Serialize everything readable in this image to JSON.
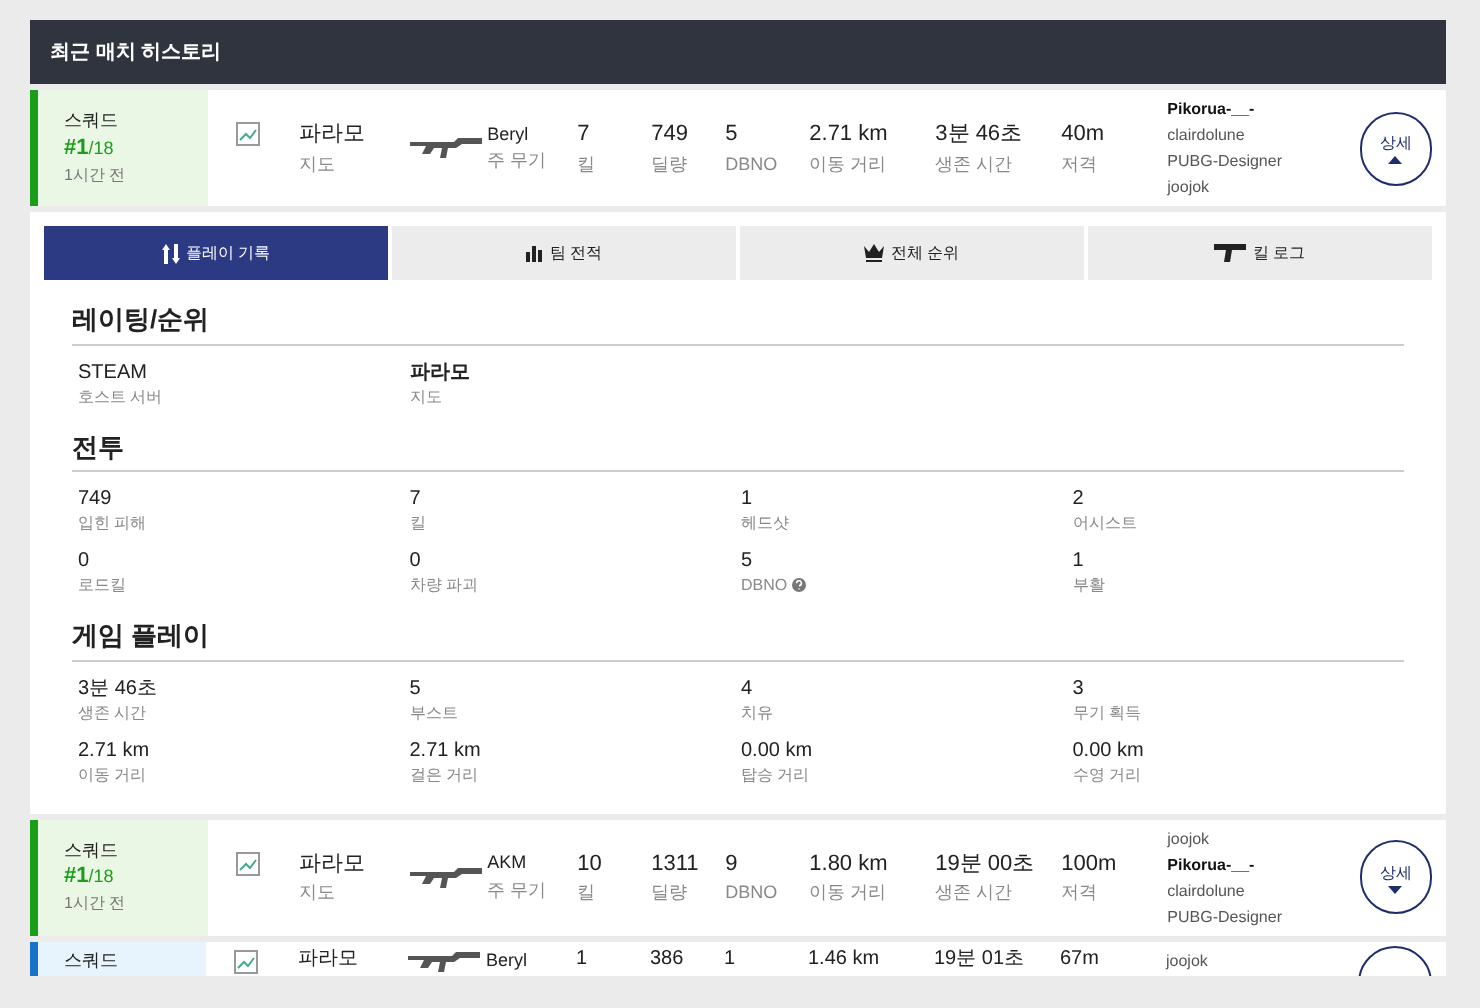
{
  "header": {
    "title": "최근 매치 히스토리"
  },
  "matches": [
    {
      "mode": "스쿼드",
      "rank": "#1",
      "total": "/18",
      "time": "1시간 전",
      "color": "#1a9e1a",
      "map": "파라모",
      "map_label": "지도",
      "weapon": "Beryl",
      "weapon_label": "주 무기",
      "stats": [
        {
          "value": "7",
          "label": "킬"
        },
        {
          "value": "749",
          "label": "딜량"
        },
        {
          "value": "5",
          "label": "DBNO"
        },
        {
          "value": "2.71 km",
          "label": "이동 거리"
        },
        {
          "value": "3분 46초",
          "label": "생존 시간"
        },
        {
          "value": "40m",
          "label": "저격"
        }
      ],
      "players": [
        {
          "name": "Pikorua-__-",
          "selected": true
        },
        {
          "name": "clairdolune",
          "selected": false
        },
        {
          "name": "PUBG-Designer",
          "selected": false
        },
        {
          "name": "joojok",
          "selected": false
        }
      ],
      "details": "상세",
      "expanded": true
    },
    {
      "mode": "스쿼드",
      "rank": "#1",
      "total": "/18",
      "time": "1시간 전",
      "color": "#1a9e1a",
      "map": "파라모",
      "map_label": "지도",
      "weapon": "AKM",
      "weapon_label": "주 무기",
      "stats": [
        {
          "value": "10",
          "label": "킬"
        },
        {
          "value": "1311",
          "label": "딜량"
        },
        {
          "value": "9",
          "label": "DBNO"
        },
        {
          "value": "1.80 km",
          "label": "이동 거리"
        },
        {
          "value": "19분 00초",
          "label": "생존 시간"
        },
        {
          "value": "100m",
          "label": "저격"
        }
      ],
      "players": [
        {
          "name": "joojok",
          "selected": false
        },
        {
          "name": "Pikorua-__-",
          "selected": true
        },
        {
          "name": "clairdolune",
          "selected": false
        },
        {
          "name": "PUBG-Designer",
          "selected": false
        }
      ],
      "details": "상세",
      "expanded": false
    },
    {
      "mode": "스쿼드",
      "color": "#1a73c9",
      "map": "파라모",
      "weapon": "Beryl",
      "stats": [
        {
          "value": "1"
        },
        {
          "value": "386"
        },
        {
          "value": "1"
        },
        {
          "value": "1.46 km"
        },
        {
          "value": "19분 01초"
        },
        {
          "value": "67m"
        }
      ],
      "players": [
        {
          "name": "joojok",
          "selected": false
        }
      ],
      "expanded": false
    }
  ],
  "tabs": [
    {
      "label": "플레이 기록",
      "selected": true
    },
    {
      "label": "팀 전적",
      "selected": false
    },
    {
      "label": "전체 순위",
      "selected": false
    },
    {
      "label": "킬 로그",
      "selected": false
    }
  ],
  "sections": [
    {
      "title": "레이팅/순위",
      "rows": [
        [
          {
            "value": "STEAM",
            "label": "호스트 서버"
          },
          {
            "value": "파라모",
            "label": "지도",
            "bold": true
          }
        ]
      ]
    },
    {
      "title": "전투",
      "rows": [
        [
          {
            "value": "749",
            "label": "입힌 피해"
          },
          {
            "value": "7",
            "label": "킬"
          },
          {
            "value": "1",
            "label": "헤드샷"
          },
          {
            "value": "2",
            "label": "어시스트"
          }
        ],
        [
          {
            "value": "0",
            "label": "로드킬"
          },
          {
            "value": "0",
            "label": "차량 파괴"
          },
          {
            "value": "5",
            "label": "DBNO",
            "help": true
          },
          {
            "value": "1",
            "label": "부활"
          }
        ]
      ]
    },
    {
      "title": "게임 플레이",
      "rows": [
        [
          {
            "value": "3분 46초",
            "label": "생존 시간"
          },
          {
            "value": "5",
            "label": "부스트"
          },
          {
            "value": "4",
            "label": "치유"
          },
          {
            "value": "3",
            "label": "무기 획득"
          }
        ],
        [
          {
            "value": "2.71 km",
            "label": "이동 거리"
          },
          {
            "value": "2.71 km",
            "label": "걸은 거리"
          },
          {
            "value": "0.00 km",
            "label": "탑승 거리"
          },
          {
            "value": "0.00 km",
            "label": "수영 거리"
          }
        ]
      ]
    }
  ]
}
